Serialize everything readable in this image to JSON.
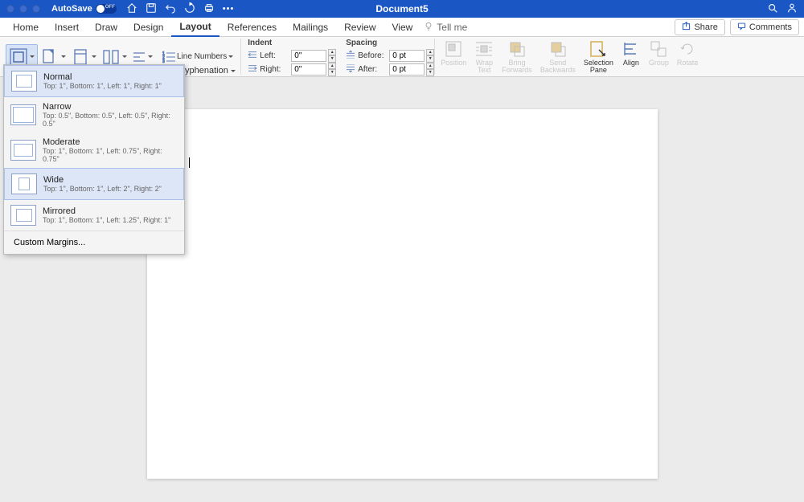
{
  "titlebar": {
    "autosave": "AutoSave",
    "autosave_state": "OFF",
    "doc_title": "Document5"
  },
  "tabs": {
    "items": [
      "Home",
      "Insert",
      "Draw",
      "Design",
      "Layout",
      "References",
      "Mailings",
      "Review",
      "View"
    ],
    "active_index": 4,
    "tellme": "Tell me",
    "share": "Share",
    "comments": "Comments"
  },
  "ribbon": {
    "line_numbers": "Line Numbers",
    "hyphenation": "yphenation",
    "indent": {
      "label": "Indent",
      "left_label": "Left:",
      "right_label": "Right:",
      "left_value": "0\"",
      "right_value": "0\""
    },
    "spacing": {
      "label": "Spacing",
      "before_label": "Before:",
      "after_label": "After:",
      "before_value": "0 pt",
      "after_value": "0 pt"
    },
    "arrange": {
      "position": "Position",
      "wrap": "Wrap\nText",
      "bring": "Bring\nForwards",
      "send": "Send\nBackwards",
      "selection": "Selection\nPane",
      "align": "Align",
      "group": "Group",
      "rotate": "Rotate"
    }
  },
  "margins_menu": {
    "items": [
      {
        "title": "Normal",
        "desc": "Top: 1\", Bottom: 1\", Left: 1\", Right: 1\""
      },
      {
        "title": "Narrow",
        "desc": "Top: 0.5\", Bottom: 0.5\", Left: 0.5\", Right: 0.5\""
      },
      {
        "title": "Moderate",
        "desc": "Top: 1\", Bottom: 1\", Left: 0.75\", Right: 0.75\""
      },
      {
        "title": "Wide",
        "desc": "Top: 1\", Bottom: 1\", Left: 2\", Right: 2\""
      },
      {
        "title": "Mirrored",
        "desc": "Top: 1\", Bottom: 1\", Left: 1.25\", Right: 1\""
      }
    ],
    "custom": "Custom Margins..."
  }
}
